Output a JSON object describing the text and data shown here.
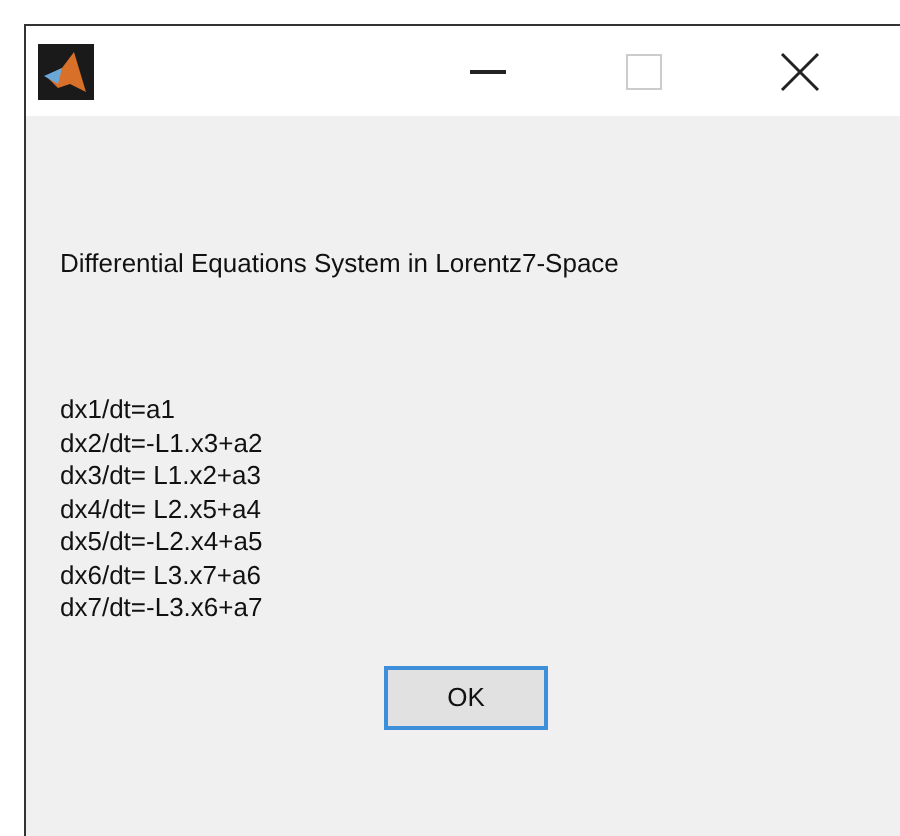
{
  "message": {
    "heading": "Differential Equations System in Lorentz7-Space",
    "lines": [
      "dx1/dt=a1",
      "dx2/dt=-L1.x3+a2",
      "dx3/dt= L1.x2+a3",
      "dx4/dt= L2.x5+a4",
      "dx5/dt=-L2.x4+a5",
      "dx6/dt= L3.x7+a6",
      "dx7/dt=-L3.x6+a7"
    ]
  },
  "buttons": [
    "OK"
  ]
}
